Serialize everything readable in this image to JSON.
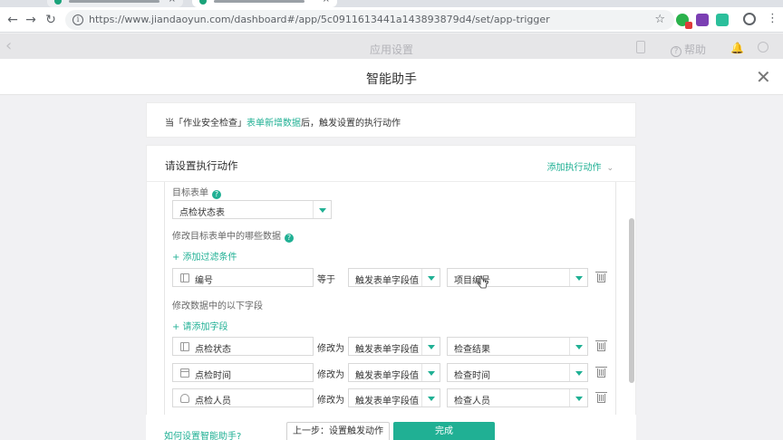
{
  "browser": {
    "url": "https://www.jiandaoyun.com/dashboard#/app/5c0911613441a143893879d4/set/app-trigger"
  },
  "app_header": {
    "title": "应用设置",
    "help": "帮助"
  },
  "modal": {
    "title": "智能助手"
  },
  "trigger": {
    "prefix": "当「作业安全检查」",
    "event": "表单新增数据",
    "suffix": "后，触发设置的执行动作"
  },
  "action_panel": {
    "title": "请设置执行动作",
    "add_action": "添加执行动作",
    "target_form_label": "目标表单",
    "target_form_value": "点检状态表",
    "filter_section_label": "修改目标表单中的哪些数据",
    "add_filter": "+ 添加过滤条件",
    "filter": {
      "field": "编号",
      "operator": "等于",
      "source_type": "触发表单字段值",
      "source_field": "项目编号"
    },
    "update_section_label": "修改数据中的以下字段",
    "add_field": "+ 请添加字段",
    "updates": [
      {
        "field": "点检状态",
        "operator": "修改为",
        "source_type": "触发表单字段值",
        "source_field": "检查结果",
        "icon": "text-field-icon"
      },
      {
        "field": "点检时间",
        "operator": "修改为",
        "source_type": "触发表单字段值",
        "source_field": "检查时间",
        "icon": "date-field-icon"
      },
      {
        "field": "点检人员",
        "operator": "修改为",
        "source_type": "触发表单字段值",
        "source_field": "检查人员",
        "icon": "member-field-icon"
      }
    ]
  },
  "footer": {
    "help_link": "如何设置智能助手?",
    "prev_button": "上一步：设置触发动作",
    "done_button": "完成"
  },
  "colors": {
    "accent": "#20b094"
  }
}
